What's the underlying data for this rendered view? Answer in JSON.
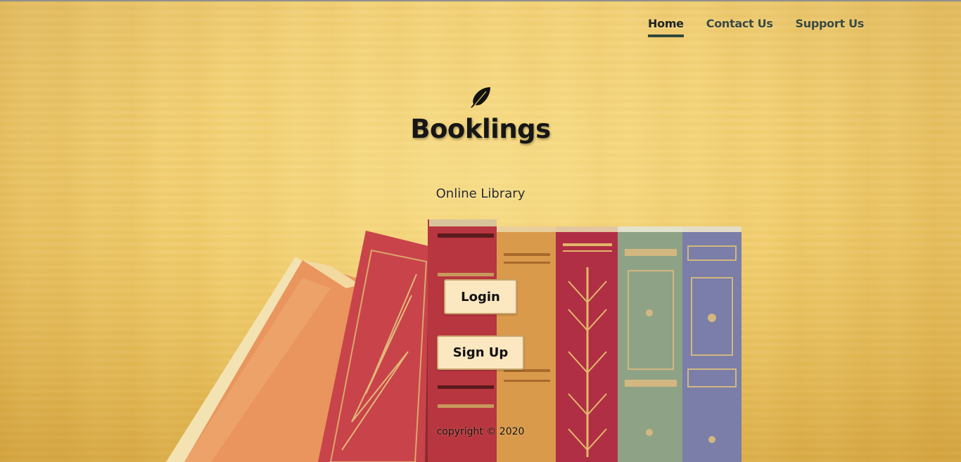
{
  "nav": {
    "items": [
      {
        "label": "Home",
        "active": true
      },
      {
        "label": "Contact Us",
        "active": false
      },
      {
        "label": "Support Us",
        "active": false
      }
    ]
  },
  "hero": {
    "logo_icon": "feather-icon",
    "title": "Booklings",
    "subtitle": "Online Library"
  },
  "actions": {
    "login_label": "Login",
    "signup_label": "Sign Up"
  },
  "footer": {
    "copyright": "copyright © 2020"
  },
  "colors": {
    "background": "#ecc55d",
    "button_bg": "#fbe7c0",
    "nav_active_underline": "#2f4a3c",
    "nav_text": "#3b4a42"
  }
}
